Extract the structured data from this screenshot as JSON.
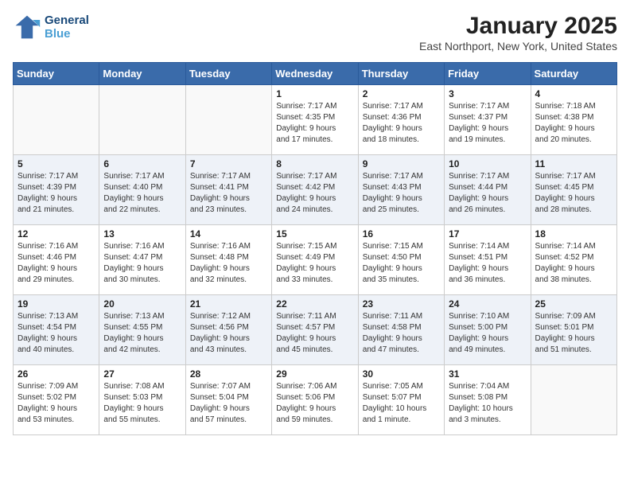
{
  "header": {
    "logo_line1": "General",
    "logo_line2": "Blue",
    "month_year": "January 2025",
    "location": "East Northport, New York, United States"
  },
  "days_of_week": [
    "Sunday",
    "Monday",
    "Tuesday",
    "Wednesday",
    "Thursday",
    "Friday",
    "Saturday"
  ],
  "weeks": [
    [
      {
        "num": "",
        "info": ""
      },
      {
        "num": "",
        "info": ""
      },
      {
        "num": "",
        "info": ""
      },
      {
        "num": "1",
        "info": "Sunrise: 7:17 AM\nSunset: 4:35 PM\nDaylight: 9 hours\nand 17 minutes."
      },
      {
        "num": "2",
        "info": "Sunrise: 7:17 AM\nSunset: 4:36 PM\nDaylight: 9 hours\nand 18 minutes."
      },
      {
        "num": "3",
        "info": "Sunrise: 7:17 AM\nSunset: 4:37 PM\nDaylight: 9 hours\nand 19 minutes."
      },
      {
        "num": "4",
        "info": "Sunrise: 7:18 AM\nSunset: 4:38 PM\nDaylight: 9 hours\nand 20 minutes."
      }
    ],
    [
      {
        "num": "5",
        "info": "Sunrise: 7:17 AM\nSunset: 4:39 PM\nDaylight: 9 hours\nand 21 minutes."
      },
      {
        "num": "6",
        "info": "Sunrise: 7:17 AM\nSunset: 4:40 PM\nDaylight: 9 hours\nand 22 minutes."
      },
      {
        "num": "7",
        "info": "Sunrise: 7:17 AM\nSunset: 4:41 PM\nDaylight: 9 hours\nand 23 minutes."
      },
      {
        "num": "8",
        "info": "Sunrise: 7:17 AM\nSunset: 4:42 PM\nDaylight: 9 hours\nand 24 minutes."
      },
      {
        "num": "9",
        "info": "Sunrise: 7:17 AM\nSunset: 4:43 PM\nDaylight: 9 hours\nand 25 minutes."
      },
      {
        "num": "10",
        "info": "Sunrise: 7:17 AM\nSunset: 4:44 PM\nDaylight: 9 hours\nand 26 minutes."
      },
      {
        "num": "11",
        "info": "Sunrise: 7:17 AM\nSunset: 4:45 PM\nDaylight: 9 hours\nand 28 minutes."
      }
    ],
    [
      {
        "num": "12",
        "info": "Sunrise: 7:16 AM\nSunset: 4:46 PM\nDaylight: 9 hours\nand 29 minutes."
      },
      {
        "num": "13",
        "info": "Sunrise: 7:16 AM\nSunset: 4:47 PM\nDaylight: 9 hours\nand 30 minutes."
      },
      {
        "num": "14",
        "info": "Sunrise: 7:16 AM\nSunset: 4:48 PM\nDaylight: 9 hours\nand 32 minutes."
      },
      {
        "num": "15",
        "info": "Sunrise: 7:15 AM\nSunset: 4:49 PM\nDaylight: 9 hours\nand 33 minutes."
      },
      {
        "num": "16",
        "info": "Sunrise: 7:15 AM\nSunset: 4:50 PM\nDaylight: 9 hours\nand 35 minutes."
      },
      {
        "num": "17",
        "info": "Sunrise: 7:14 AM\nSunset: 4:51 PM\nDaylight: 9 hours\nand 36 minutes."
      },
      {
        "num": "18",
        "info": "Sunrise: 7:14 AM\nSunset: 4:52 PM\nDaylight: 9 hours\nand 38 minutes."
      }
    ],
    [
      {
        "num": "19",
        "info": "Sunrise: 7:13 AM\nSunset: 4:54 PM\nDaylight: 9 hours\nand 40 minutes."
      },
      {
        "num": "20",
        "info": "Sunrise: 7:13 AM\nSunset: 4:55 PM\nDaylight: 9 hours\nand 42 minutes."
      },
      {
        "num": "21",
        "info": "Sunrise: 7:12 AM\nSunset: 4:56 PM\nDaylight: 9 hours\nand 43 minutes."
      },
      {
        "num": "22",
        "info": "Sunrise: 7:11 AM\nSunset: 4:57 PM\nDaylight: 9 hours\nand 45 minutes."
      },
      {
        "num": "23",
        "info": "Sunrise: 7:11 AM\nSunset: 4:58 PM\nDaylight: 9 hours\nand 47 minutes."
      },
      {
        "num": "24",
        "info": "Sunrise: 7:10 AM\nSunset: 5:00 PM\nDaylight: 9 hours\nand 49 minutes."
      },
      {
        "num": "25",
        "info": "Sunrise: 7:09 AM\nSunset: 5:01 PM\nDaylight: 9 hours\nand 51 minutes."
      }
    ],
    [
      {
        "num": "26",
        "info": "Sunrise: 7:09 AM\nSunset: 5:02 PM\nDaylight: 9 hours\nand 53 minutes."
      },
      {
        "num": "27",
        "info": "Sunrise: 7:08 AM\nSunset: 5:03 PM\nDaylight: 9 hours\nand 55 minutes."
      },
      {
        "num": "28",
        "info": "Sunrise: 7:07 AM\nSunset: 5:04 PM\nDaylight: 9 hours\nand 57 minutes."
      },
      {
        "num": "29",
        "info": "Sunrise: 7:06 AM\nSunset: 5:06 PM\nDaylight: 9 hours\nand 59 minutes."
      },
      {
        "num": "30",
        "info": "Sunrise: 7:05 AM\nSunset: 5:07 PM\nDaylight: 10 hours\nand 1 minute."
      },
      {
        "num": "31",
        "info": "Sunrise: 7:04 AM\nSunset: 5:08 PM\nDaylight: 10 hours\nand 3 minutes."
      },
      {
        "num": "",
        "info": ""
      }
    ]
  ]
}
